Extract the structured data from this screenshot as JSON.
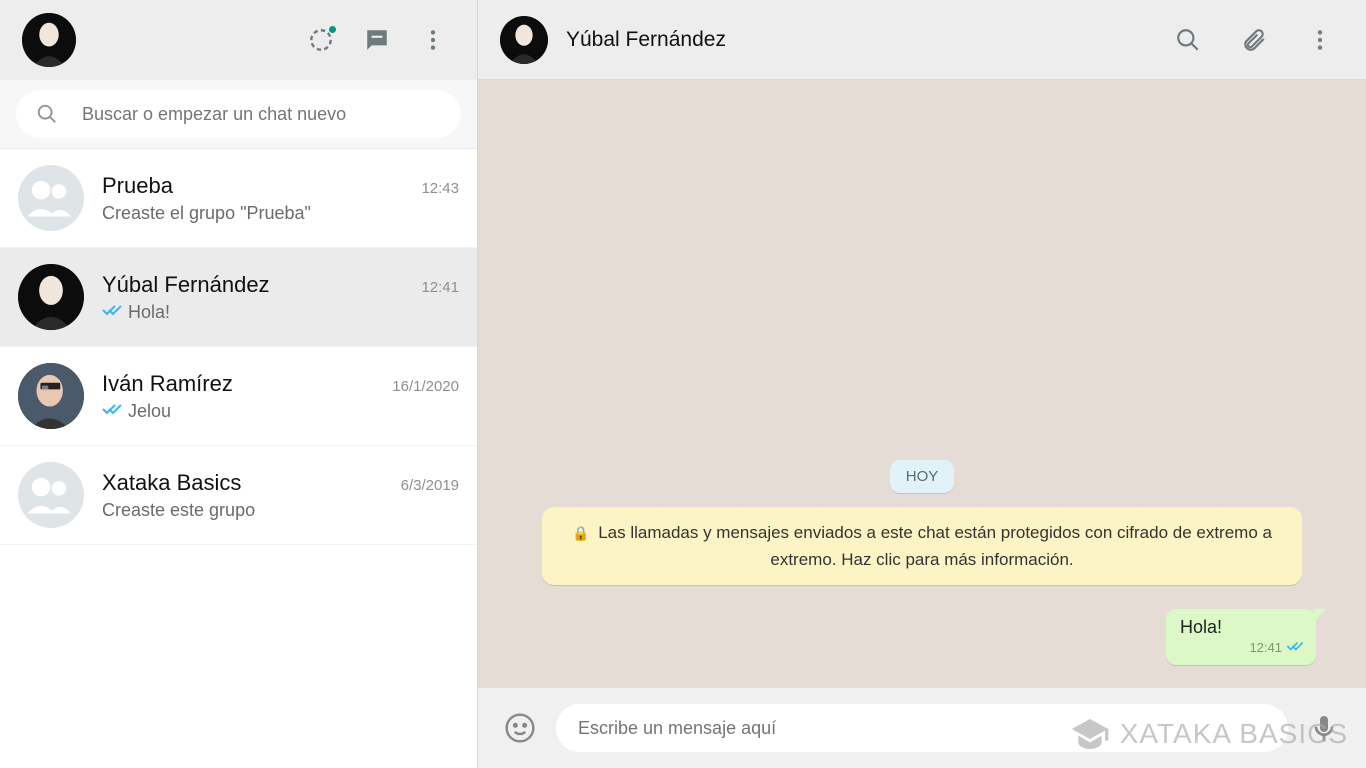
{
  "sidebar": {
    "search_placeholder": "Buscar o empezar un chat nuevo",
    "chats": [
      {
        "name": "Prueba",
        "time": "12:43",
        "preview": "Creaste el grupo \"Prueba\"",
        "read": false,
        "group": true,
        "dark": false
      },
      {
        "name": "Yúbal Fernández",
        "time": "12:41",
        "preview": "Hola!",
        "read": true,
        "group": false,
        "dark": true
      },
      {
        "name": "Iván Ramírez",
        "time": "16/1/2020",
        "preview": "Jelou",
        "read": true,
        "group": false,
        "dark": false
      },
      {
        "name": "Xataka Basics",
        "time": "6/3/2019",
        "preview": "Creaste este grupo",
        "read": false,
        "group": true,
        "dark": false
      }
    ]
  },
  "conversation": {
    "title": "Yúbal Fernández",
    "date_label": "HOY",
    "encryption_notice": "Las llamadas y mensajes enviados a este chat están protegidos con cifrado de extremo a extremo. Haz clic para más información.",
    "messages": [
      {
        "text": "Hola!",
        "time": "12:41",
        "out": true,
        "read": true
      }
    ],
    "composer_placeholder": "Escribe un mensaje aquí"
  },
  "watermark": "XATAKA BASICS"
}
